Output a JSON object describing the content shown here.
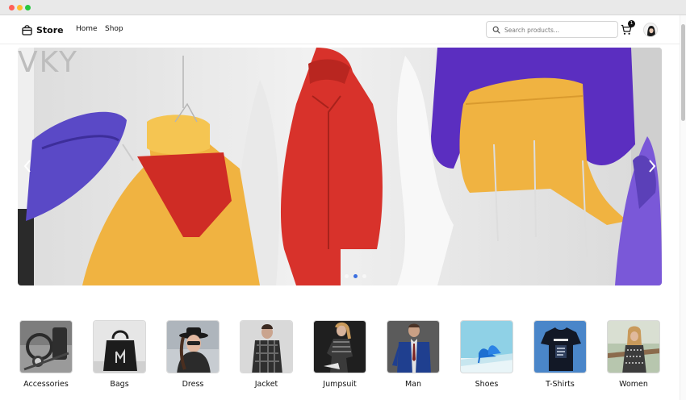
{
  "navbar": {
    "brand": "Store",
    "links": [
      "Home",
      "Shop"
    ],
    "search": {
      "placeholder": "Search products...",
      "value": ""
    },
    "cart_count": "1"
  },
  "hero": {
    "slides": 3,
    "active_slide": 2,
    "backdrop_letters": "VKY"
  },
  "categories": [
    {
      "label": "Accessories",
      "icon": "accessories-photo"
    },
    {
      "label": "Bags",
      "icon": "bag-photo"
    },
    {
      "label": "Dress",
      "icon": "dress-photo"
    },
    {
      "label": "Jacket",
      "icon": "jacket-photo"
    },
    {
      "label": "Jumpsuit",
      "icon": "jumpsuit-photo"
    },
    {
      "label": "Man",
      "icon": "suit-photo"
    },
    {
      "label": "Shoes",
      "icon": "shoes-photo"
    },
    {
      "label": "T-Shirts",
      "icon": "tshirt-photo"
    },
    {
      "label": "Women",
      "icon": "women-photo"
    }
  ],
  "colors": {
    "accent": "#3b6fe0",
    "titlebar": "#e9e9e9"
  }
}
